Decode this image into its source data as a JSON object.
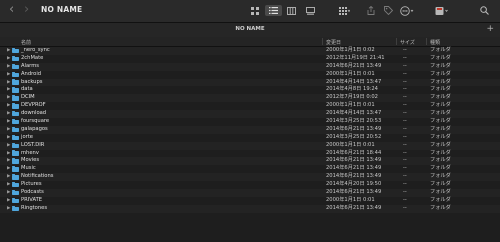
{
  "window": {
    "title": "NO NAME",
    "nav_back": "‹",
    "nav_forward": "›"
  },
  "pathbar": {
    "label": "NO NAME",
    "add": "+"
  },
  "columns": {
    "name": "名前",
    "date": "変更日",
    "size": "サイズ",
    "kind": "種類"
  },
  "icons": {
    "back": "chevron-left-icon",
    "forward": "chevron-right-icon",
    "view_icon": "grid-view-icon",
    "view_list": "list-view-icon",
    "view_columns": "column-view-icon",
    "view_gallery": "gallery-view-icon",
    "group": "group-icon",
    "share": "share-icon",
    "tag": "tag-icon",
    "action": "ellipsis-icon",
    "folder": "folder-icon",
    "disclosure": "disclosure-triangle-icon"
  },
  "colors": {
    "folder": "#4fa6dc",
    "background": "#1e1e1e",
    "row_alt": "#232323"
  },
  "files": [
    {
      "name": "_nero_sync",
      "date": "2000年1月1日 0:02",
      "size": "--",
      "kind": "フォルダ"
    },
    {
      "name": "2chMate",
      "date": "2012年11月19日 21:41",
      "size": "--",
      "kind": "フォルダ"
    },
    {
      "name": "Alarms",
      "date": "2014年6月21日 13:49",
      "size": "--",
      "kind": "フォルダ"
    },
    {
      "name": "Android",
      "date": "2000年1月1日 0:01",
      "size": "--",
      "kind": "フォルダ"
    },
    {
      "name": "backups",
      "date": "2014年4月14日 13:47",
      "size": "--",
      "kind": "フォルダ"
    },
    {
      "name": "data",
      "date": "2014年4月8日 19:24",
      "size": "--",
      "kind": "フォルダ"
    },
    {
      "name": "DCIM",
      "date": "2012年7月19日 0:02",
      "size": "--",
      "kind": "フォルダ"
    },
    {
      "name": "DEVPROF",
      "date": "2000年1月1日 0:01",
      "size": "--",
      "kind": "フォルダ"
    },
    {
      "name": "download",
      "date": "2014年4月14日 13:47",
      "size": "--",
      "kind": "フォルダ"
    },
    {
      "name": "foursquare",
      "date": "2014年3月25日 20:53",
      "size": "--",
      "kind": "フォルダ"
    },
    {
      "name": "galapagos",
      "date": "2014年6月21日 13:49",
      "size": "--",
      "kind": "フォルダ"
    },
    {
      "name": "jorte",
      "date": "2014年3月25日 20:52",
      "size": "--",
      "kind": "フォルダ"
    },
    {
      "name": "LOST.DIR",
      "date": "2000年1月1日 0:01",
      "size": "--",
      "kind": "フォルダ"
    },
    {
      "name": "mhenv",
      "date": "2014年6月21日 18:44",
      "size": "--",
      "kind": "フォルダ"
    },
    {
      "name": "Movies",
      "date": "2014年6月21日 13:49",
      "size": "--",
      "kind": "フォルダ"
    },
    {
      "name": "Music",
      "date": "2014年6月21日 13:49",
      "size": "--",
      "kind": "フォルダ"
    },
    {
      "name": "Notifications",
      "date": "2014年6月21日 13:49",
      "size": "--",
      "kind": "フォルダ"
    },
    {
      "name": "Pictures",
      "date": "2014年4月20日 19:50",
      "size": "--",
      "kind": "フォルダ"
    },
    {
      "name": "Podcasts",
      "date": "2014年6月21日 13:49",
      "size": "--",
      "kind": "フォルダ"
    },
    {
      "name": "PRIVATE",
      "date": "2000年1月1日 0:01",
      "size": "--",
      "kind": "フォルダ"
    },
    {
      "name": "Ringtones",
      "date": "2014年6月21日 13:49",
      "size": "--",
      "kind": "フォルダ"
    }
  ]
}
